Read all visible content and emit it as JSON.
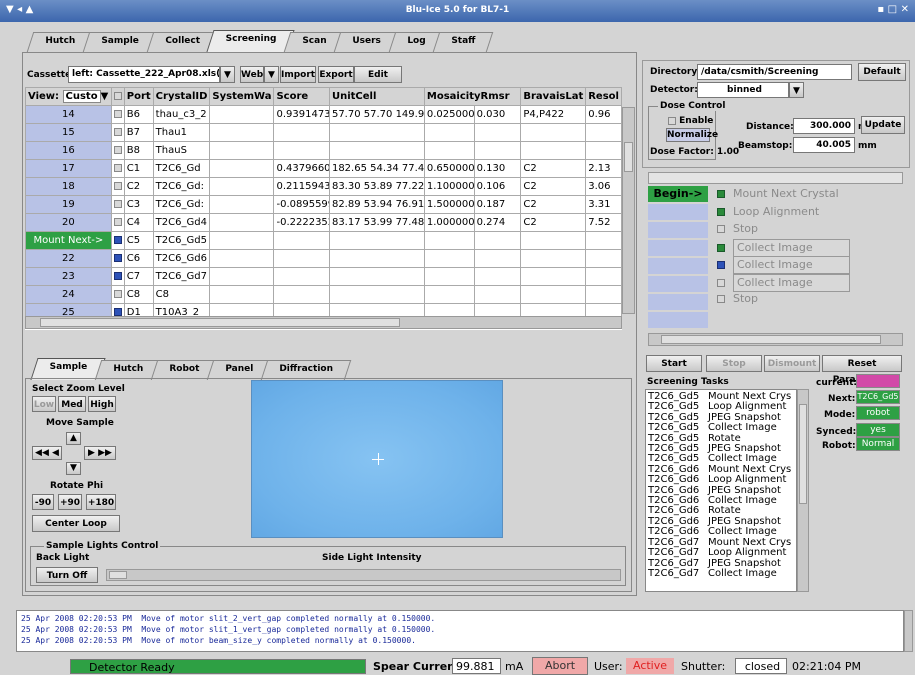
{
  "window": {
    "title": "Blu-Ice 5.0 for BL7-1",
    "left_icons": "▼ ◂ ▲",
    "right_icons": "▪ □ ✕"
  },
  "main_tabs": [
    "Hutch",
    "Sample",
    "Collect",
    "Screening",
    "Scan",
    "Users",
    "Log",
    "Staff"
  ],
  "cassette": {
    "label": "Cassette:",
    "value": "left: Cassette_222_Apr08.xls(csm",
    "web": "Web",
    "import": "Import",
    "export": "Export",
    "edit": "Edit"
  },
  "table": {
    "view_label": "View:",
    "view_value": "Custo",
    "columns": [
      "Port",
      "CrystalID",
      "SystemWa",
      "Score",
      "UnitCell",
      "MosaicityRmsr",
      "",
      "BravaisLat",
      "Resol"
    ],
    "rows": [
      {
        "label": "14",
        "checked": false,
        "port": "B6",
        "id": "thau_c3_2",
        "sys": "",
        "score": "0.939147302483",
        "cell": "57.70 57.70 149.97 90.00",
        "mos": "0.025000",
        "rmsr": "0.030",
        "brav": "P4,P422",
        "resol": "0.96"
      },
      {
        "label": "15",
        "checked": false,
        "port": "B7",
        "id": "Thau1",
        "sys": "",
        "score": "",
        "cell": "",
        "mos": "",
        "rmsr": "",
        "brav": "",
        "resol": ""
      },
      {
        "label": "16",
        "checked": false,
        "port": "B8",
        "id": "ThauS",
        "sys": "",
        "score": "",
        "cell": "",
        "mos": "",
        "rmsr": "",
        "brav": "",
        "resol": ""
      },
      {
        "label": "17",
        "checked": false,
        "port": "C1",
        "id": "T2C6_Gd",
        "sys": "",
        "score": "0.437966051",
        "cell": "182.65 54.34 77.46 90.00",
        "mos": "0.650000",
        "rmsr": "0.130",
        "brav": "C2",
        "resol": "2.13"
      },
      {
        "label": "18",
        "checked": false,
        "port": "C2",
        "id": "T2C6_Gd:",
        "sys": "",
        "score": "0.211594391",
        "cell": "83.30 53.89 77.22 90.00",
        "mos": "1.100000",
        "rmsr": "0.106",
        "brav": "C2",
        "resol": "3.06"
      },
      {
        "label": "19",
        "checked": false,
        "port": "C3",
        "id": "T2C6_Gd:",
        "sys": "",
        "score": "-0.089559964",
        "cell": "82.89 53.94 76.91 90.00",
        "mos": "1.500000",
        "rmsr": "0.187",
        "brav": "C2",
        "resol": "3.31"
      },
      {
        "label": "20",
        "checked": false,
        "port": "C4",
        "id": "T2C6_Gd4",
        "sys": "",
        "score": "-0.222235252",
        "cell": "83.17 53.99 77.48 90.00",
        "mos": "1.000000",
        "rmsr": "0.274",
        "brav": "C2",
        "resol": "7.52"
      },
      {
        "label": "Mount Next->",
        "checked": true,
        "port": "C5",
        "id": "T2C6_Gd5",
        "sys": "",
        "score": "",
        "cell": "",
        "mos": "",
        "rmsr": "",
        "brav": "",
        "resol": ""
      },
      {
        "label": "22",
        "checked": true,
        "port": "C6",
        "id": "T2C6_Gd6",
        "sys": "",
        "score": "",
        "cell": "",
        "mos": "",
        "rmsr": "",
        "brav": "",
        "resol": ""
      },
      {
        "label": "23",
        "checked": true,
        "port": "C7",
        "id": "T2C6_Gd7",
        "sys": "",
        "score": "",
        "cell": "",
        "mos": "",
        "rmsr": "",
        "brav": "",
        "resol": ""
      },
      {
        "label": "24",
        "checked": false,
        "port": "C8",
        "id": "C8",
        "sys": "",
        "score": "",
        "cell": "",
        "mos": "",
        "rmsr": "",
        "brav": "",
        "resol": ""
      },
      {
        "label": "25",
        "checked": true,
        "port": "D1",
        "id": "T10A3_2",
        "sys": "",
        "score": "",
        "cell": "",
        "mos": "",
        "rmsr": "",
        "brav": "",
        "resol": ""
      }
    ]
  },
  "sub_tabs": [
    "Sample",
    "Hutch",
    "Robot",
    "Panel",
    "Diffraction"
  ],
  "sample": {
    "zoom_label": "Select Zoom Level",
    "low": "Low",
    "med": "Med",
    "high": "High",
    "move_label": "Move Sample",
    "rotate_label": "Rotate Phi",
    "rot1": "-90",
    "rot2": "+90",
    "rot3": "+180",
    "center": "Center Loop",
    "lights_title": "Sample Lights Control",
    "back_light": "Back Light",
    "side_light": "Side Light Intensity",
    "turn_off": "Turn Off"
  },
  "right": {
    "dir_label": "Directory:",
    "dir_value": "/data/csmith/Screening",
    "default": "Default",
    "det_label": "Detector:",
    "det_value": "binned",
    "dose_title": "Dose Control",
    "enable": "Enable",
    "normalize": "Normalize",
    "dose_factor": "Dose Factor: 1.00",
    "distance_label": "Distance:",
    "distance_value": "300.000",
    "beamstop_label": "Beamstop:",
    "beamstop_value": "40.005",
    "unit": "mm",
    "update": "Update",
    "begin": "Begin->",
    "steps": [
      {
        "label": "Mount Next Crystal",
        "state": "green",
        "boxed": false
      },
      {
        "label": "Loop Alignment",
        "state": "green",
        "boxed": false
      },
      {
        "label": "Stop",
        "state": "off",
        "boxed": false
      },
      {
        "label": "Collect Image",
        "state": "green",
        "boxed": true
      },
      {
        "label": "Collect Image",
        "state": "blue",
        "boxed": true
      },
      {
        "label": "Collect Image",
        "state": "off",
        "boxed": true
      },
      {
        "label": "Stop",
        "state": "off",
        "boxed": false
      }
    ],
    "start": "Start",
    "stop": "Stop",
    "dismount": "Dismount",
    "reset": "Reset Parameters",
    "tasks_title": "Screening Tasks",
    "tasks": [
      [
        "T2C6_Gd5",
        "Mount Next Crys"
      ],
      [
        "T2C6_Gd5",
        "Loop Alignment"
      ],
      [
        "T2C6_Gd5",
        "JPEG Snapshot"
      ],
      [
        "T2C6_Gd5",
        "Collect Image"
      ],
      [
        "T2C6_Gd5",
        "Rotate"
      ],
      [
        "T2C6_Gd5",
        "JPEG Snapshot"
      ],
      [
        "T2C6_Gd5",
        "Collect Image"
      ],
      [
        "T2C6_Gd6",
        "Mount Next Crys"
      ],
      [
        "T2C6_Gd6",
        "Loop Alignment"
      ],
      [
        "T2C6_Gd6",
        "JPEG Snapshot"
      ],
      [
        "T2C6_Gd6",
        "Collect Image"
      ],
      [
        "T2C6_Gd6",
        "Rotate"
      ],
      [
        "T2C6_Gd6",
        "JPEG Snapshot"
      ],
      [
        "T2C6_Gd6",
        "Collect Image"
      ],
      [
        "T2C6_Gd7",
        "Mount Next Crys"
      ],
      [
        "T2C6_Gd7",
        "Loop Alignment"
      ],
      [
        "T2C6_Gd7",
        "JPEG Snapshot"
      ],
      [
        "T2C6_Gd7",
        "Collect Image"
      ]
    ],
    "current_label": "current:",
    "next_label": "Next:",
    "next_value": "T2C6_Gd5",
    "mode_label": "Mode:",
    "mode_value": "robot",
    "synced_label": "Synced:",
    "synced_value": "yes",
    "robot_label": "Robot:",
    "robot_value": "Normal"
  },
  "log": [
    "25 Apr 2008 02:20:53 PM  Move of motor slit_2_vert_gap completed normally at 0.150000.",
    "25 Apr 2008 02:20:53 PM  Move of motor slit_1_vert_gap completed normally at 0.150000.",
    "25 Apr 2008 02:20:53 PM  Move of motor beam_size_y completed normally at 0.150000."
  ],
  "status": {
    "detector": "Detector Ready",
    "spear_label": "Spear Current:",
    "spear_value": "99.881",
    "spear_unit": "mA",
    "abort": "Abort",
    "user_label": "User:",
    "user_value": "Active",
    "shutter_label": "Shutter:",
    "shutter_value": "closed",
    "time": "02:21:04 PM"
  },
  "colors": {
    "row_label": "#b8c2e6",
    "mount_next": "#2ea044",
    "image_bg": "#6fb4ec",
    "detector_ready": "#2ea044",
    "abort": "#f0a8a8",
    "active_text": "#e02020"
  }
}
